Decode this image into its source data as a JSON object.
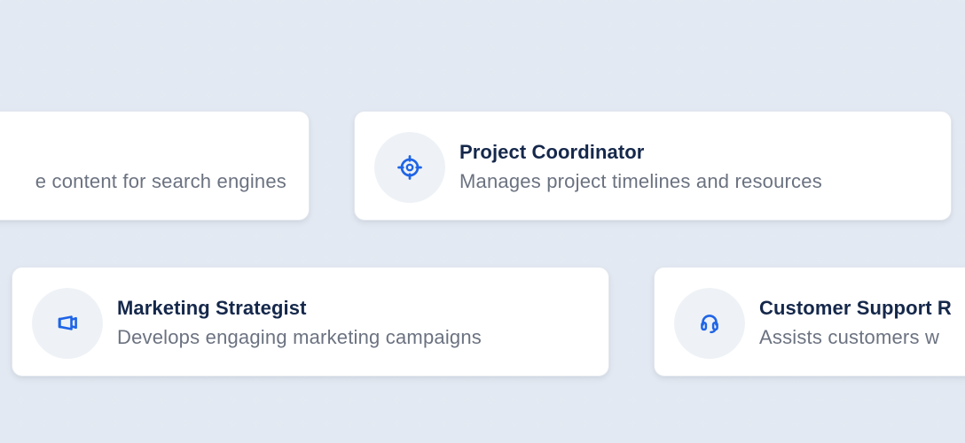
{
  "cards": [
    {
      "title": "",
      "description": "e content for search engines",
      "icon": ""
    },
    {
      "title": "Project Coordinator",
      "description": "Manages project timelines and resources",
      "icon": "target-icon"
    },
    {
      "title": "Marketing Strategist",
      "description": "Develops engaging marketing campaigns",
      "icon": "megaphone-icon"
    },
    {
      "title": "Customer Support R",
      "description": "Assists customers w",
      "icon": "headset-icon"
    }
  ],
  "colors": {
    "background": "#fafbfd",
    "card": "#ffffff",
    "title": "#15284b",
    "description": "#6b7280",
    "icon": "#1f64e6",
    "icon_bg": "#eef2f6"
  }
}
